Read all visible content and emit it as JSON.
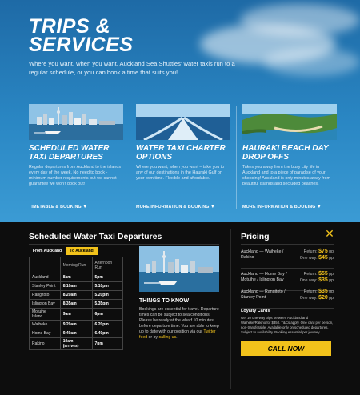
{
  "hero": {
    "title_line1": "TRIPS &",
    "title_line2": "SERVICES",
    "description": "Where you want, when you want. Auckland Sea Shuttles' water taxis run to a regular schedule, or you can book a time that suits you!"
  },
  "cards": [
    {
      "title": "SCHEDULED WATER TAXI DEPARTURES",
      "description": "Regular departures from Auckland to the islands every day of the week. No need to book - minimum number requirements but we cannot guarantee we won't book out!",
      "link": "TIMETABLE & BOOKING ▼"
    },
    {
      "title": "WATER TAXI CHARTER OPTIONS",
      "description": "Where you want, when you want – take you to any of our destinations in the Hauraki Gulf on your own time. Flexible and affordable.",
      "link": "MORE INFORMATION & BOOKING ▼"
    },
    {
      "title": "HAURAKI BEACH DAY DROP OFFS",
      "description": "Takes you away from the busy city life in Auckland and to a piece of paradise of your choosing! Auckland is only minutes away from beautiful islands and secluded beaches.",
      "link": "MORE INFORMATION & BOOKING ▼"
    }
  ],
  "schedule": {
    "title": "Scheduled Water Taxi Departures",
    "tabs": [
      "From Auckland",
      "To Auckland"
    ],
    "columns": [
      "",
      "Morning Run",
      "Afternoon Run"
    ],
    "rows": [
      [
        "Auckland",
        "8am",
        "5pm"
      ],
      [
        "Stanley Point",
        "8.10am",
        "5.10pm"
      ],
      [
        "Rangitoto",
        "8.20am",
        "5.20pm"
      ],
      [
        "Islington Bay",
        "8.35am",
        "5.35pm"
      ],
      [
        "Motuihe Island",
        "9am",
        "6pm"
      ],
      [
        "Waiheke",
        "9.20am",
        "6.20pm"
      ],
      [
        "Home Bay",
        "9.40am",
        "6.40pm"
      ],
      [
        "Rakino",
        "10am (arrives)",
        "7pm"
      ]
    ]
  },
  "things_to_know": {
    "title": "THINGS TO KNOW",
    "text": "Bookings are essential for travel. Departure times can be subject to sea conditions. Please be ready at the wharf 10 minutes before departure time. You are able to keep up to date with our position via our ",
    "link1": "Twitter feed",
    "mid": " or by ",
    "link2": "calling us",
    "end": "."
  },
  "pricing": {
    "title": "Pricing",
    "close_icon": "close-icon",
    "rows": [
      {
        "route": "Auckland — Waiheke / Rakino",
        "return_label": "Return:",
        "return_price": "$75",
        "one_label": "One way:",
        "one_price": "$45",
        "unit": "pp"
      },
      {
        "route": "Auckland — Home Bay / Motuihe / Islington Bay",
        "return_label": "Return:",
        "return_price": "$55",
        "one_label": "One way:",
        "one_price": "$35",
        "unit": "pp"
      },
      {
        "route": "Auckland — Rangitoto / Stanley Point",
        "return_label": "Return:",
        "return_price": "$35",
        "one_label": "One way:",
        "one_price": "$20",
        "unit": "pp"
      }
    ],
    "loyalty_title": "Loyalty Cards",
    "loyalty_text": "Get 10 one-way trips between Auckland and Waiheke/Rakino for $350. T&Cs apply. One card per person, non-transferable. Available only on scheduled departures. Subject to availability. Booking essential per journey.",
    "cta": "CALL NOW"
  },
  "colors": {
    "accent": "#f2c21b",
    "sky": "#2a87c4",
    "panel": "#0d0d0d"
  }
}
